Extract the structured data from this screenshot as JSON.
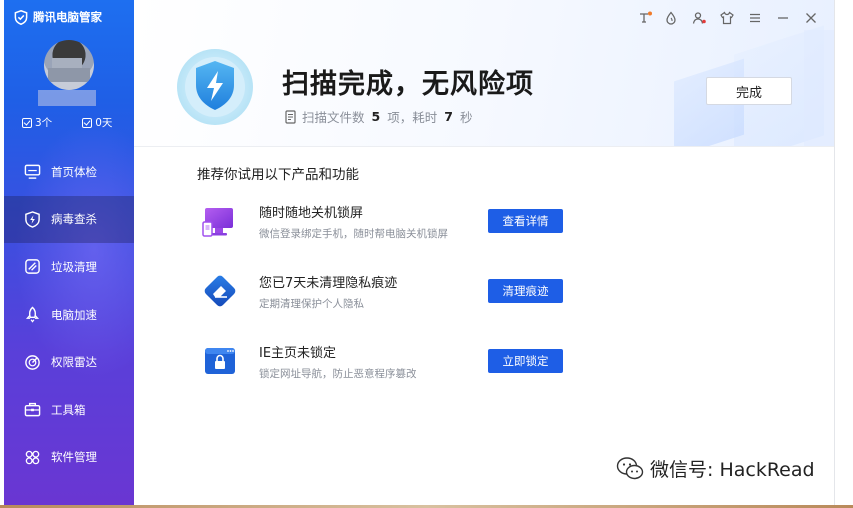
{
  "app": {
    "brand": "腾讯电脑管家",
    "user": {
      "stat_tasks": "3个",
      "stat_days": "0天"
    }
  },
  "sidebar": {
    "items": [
      {
        "label": "首页体检",
        "icon": "monitor-icon",
        "active": false
      },
      {
        "label": "病毒查杀",
        "icon": "lightning-shield-icon",
        "active": true
      },
      {
        "label": "垃圾清理",
        "icon": "broom-icon",
        "active": false
      },
      {
        "label": "电脑加速",
        "icon": "rocket-icon",
        "active": false
      },
      {
        "label": "权限雷达",
        "icon": "radar-icon",
        "active": false
      },
      {
        "label": "工具箱",
        "icon": "toolbox-icon",
        "active": false
      },
      {
        "label": "软件管理",
        "icon": "apps-icon",
        "active": false
      }
    ]
  },
  "header": {
    "title": "扫描完成，无风险项",
    "sub_prefix": "扫描文件数",
    "files_count": "5",
    "sub_mid": "项，耗时",
    "seconds": "7",
    "sub_suffix": "秒",
    "done_label": "完成"
  },
  "window_controls": [
    "tip-icon",
    "flame-icon",
    "user-alert-icon",
    "skin-icon",
    "menu-icon",
    "minimize-icon",
    "close-icon"
  ],
  "recommend": {
    "title": "推荐你试用以下产品和功能",
    "items": [
      {
        "title": "随时随地关机锁屏",
        "desc": "微信登录绑定手机，随时帮电脑关机锁屏",
        "button": "查看详情",
        "icon": "monitor-lock-icon"
      },
      {
        "title": "您已7天未清理隐私痕迹",
        "desc": "定期清理保护个人隐私",
        "button": "清理痕迹",
        "icon": "eraser-icon"
      },
      {
        "title": "IE主页未锁定",
        "desc": "锁定网址导航，防止恶意程序篡改",
        "button": "立即锁定",
        "icon": "browser-lock-icon"
      }
    ]
  },
  "watermark": "微信号: HackRead",
  "colors": {
    "accent": "#1e5ee6",
    "sidebar_top": "#1e6ff0",
    "sidebar_bottom": "#6a36d2"
  }
}
